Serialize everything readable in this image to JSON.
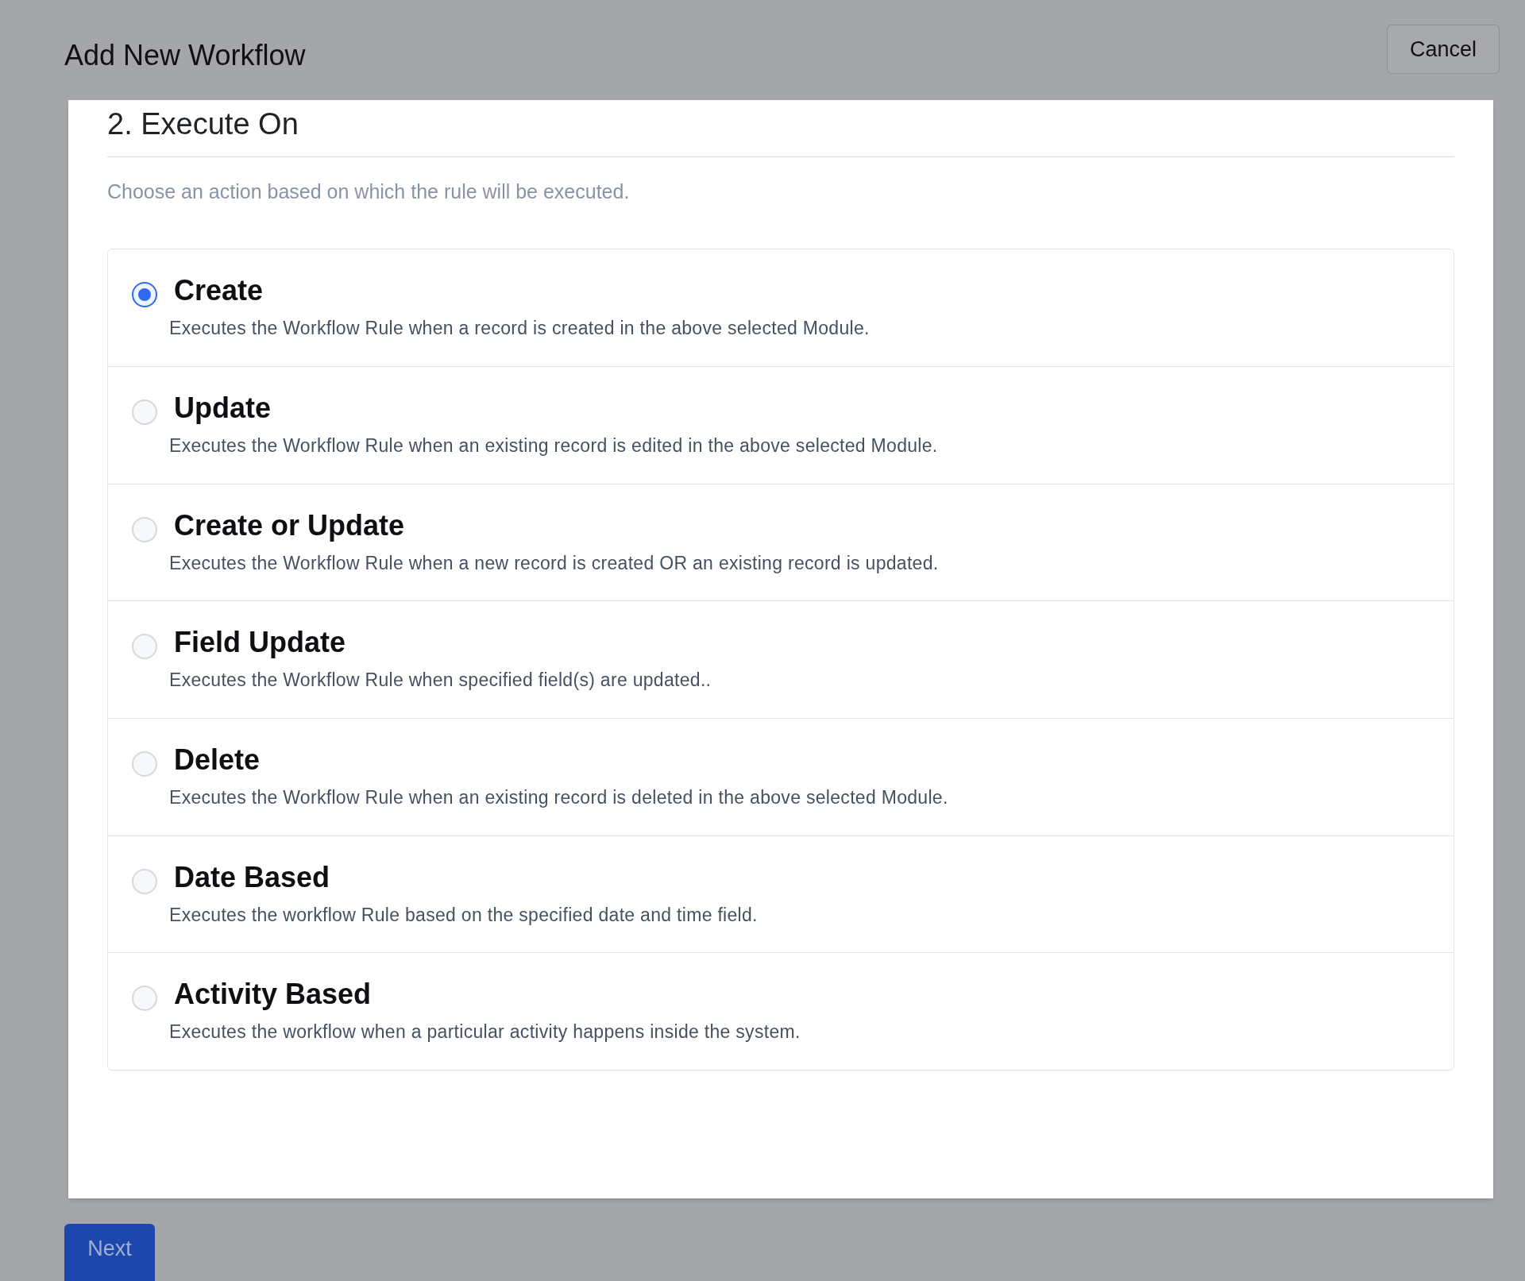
{
  "header": {
    "title": "Add New Workflow",
    "cancel_button": "Cancel"
  },
  "section": {
    "title": "2. Execute On",
    "description": "Choose an action based on which the rule will be executed."
  },
  "options": [
    {
      "label": "Create",
      "description": "Executes the Workflow Rule when a record is created in the above selected Module.",
      "selected": true
    },
    {
      "label": "Update",
      "description": "Executes the Workflow Rule when an existing record is edited in the above selected Module.",
      "selected": false
    },
    {
      "label": "Create or Update",
      "description": "Executes the Workflow Rule when a new record is created OR an existing record is updated.",
      "selected": false
    },
    {
      "label": "Field Update",
      "description": "Executes the Workflow Rule when specified field(s) are updated..",
      "selected": false
    },
    {
      "label": "Delete",
      "description": "Executes the Workflow Rule when an existing record is deleted in the above selected Module.",
      "selected": false
    },
    {
      "label": "Date Based",
      "description": "Executes the workflow Rule based on the specified date and time field.",
      "selected": false
    },
    {
      "label": "Activity Based",
      "description": "Executes the workflow when a particular activity happens inside the system.",
      "selected": false
    }
  ],
  "footer": {
    "next_button": "Next"
  }
}
